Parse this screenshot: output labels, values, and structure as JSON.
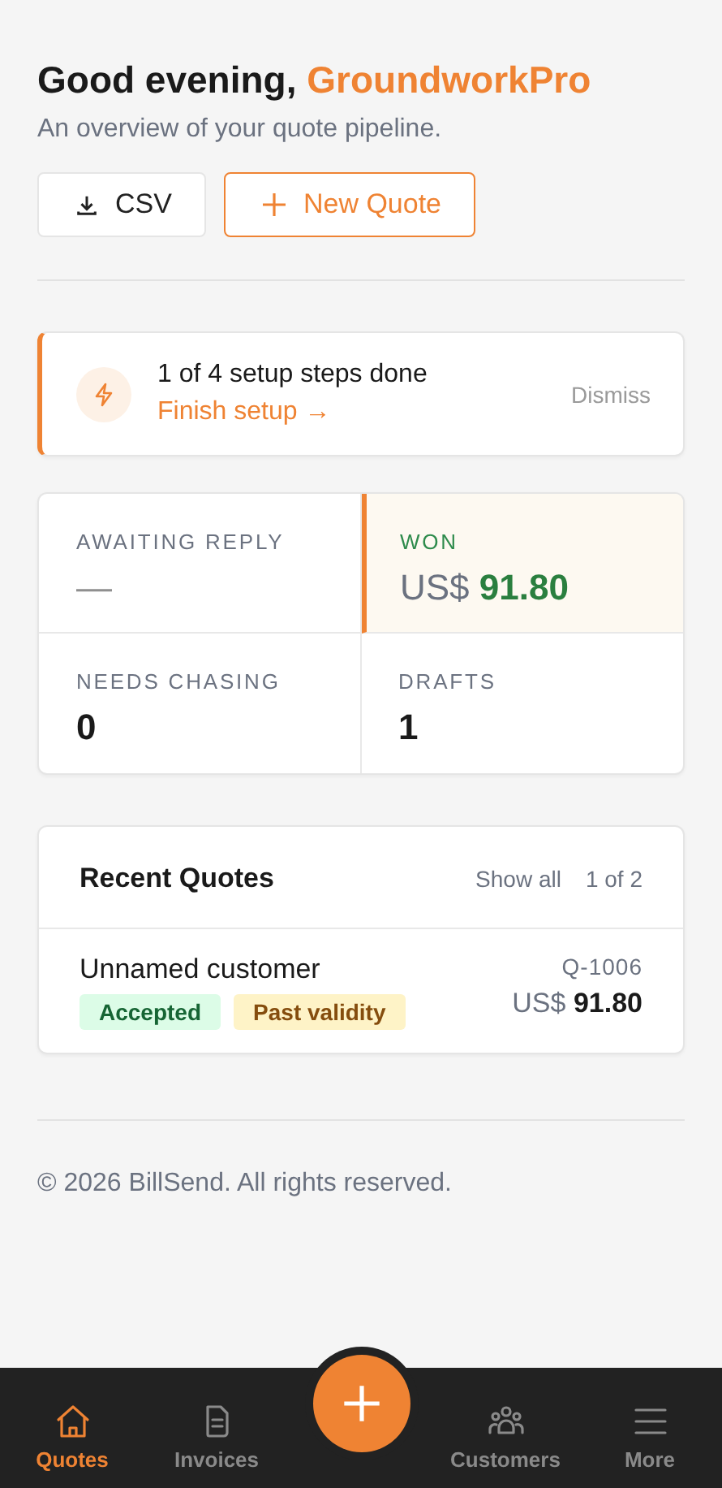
{
  "header": {
    "greeting": "Good evening,",
    "name": "GroundworkPro",
    "subtitle": "An overview of your quote pipeline."
  },
  "actions": [
    {
      "kind": "download",
      "label": "CSV"
    },
    {
      "kind": "add",
      "label": "New Quote"
    }
  ],
  "setup": {
    "progress": "1 of 4 setup steps done",
    "link": "Finish setup →",
    "dismiss": "Dismiss"
  },
  "stats": [
    {
      "label": "AWAITING REPLY",
      "value": "—",
      "empty": true,
      "highlighted": false
    },
    {
      "label": "WON",
      "prefix": "US$",
      "value": "91.80",
      "empty": false,
      "highlighted": true
    },
    {
      "label": "NEEDS CHASING",
      "value": "0",
      "empty": false,
      "highlighted": false
    },
    {
      "label": "DRAFTS",
      "value": "1",
      "empty": false,
      "highlighted": false
    }
  ],
  "recent_quotes": {
    "title": "Recent Quotes",
    "show_all": "Show all",
    "page": "1 of 2",
    "rows": [
      {
        "customer": "Unnamed customer",
        "number": "Q-1006",
        "currency": "US$",
        "amount": "91.80",
        "tags": [
          {
            "label": "Accepted",
            "color": "#dcfce7"
          },
          {
            "label": "Past validity",
            "color": "#fef3c7"
          }
        ]
      }
    ]
  },
  "footer": "© 2026 BillSend. All rights reserved.",
  "nav": [
    {
      "kind": "home",
      "label": "Quotes",
      "selected": true
    },
    {
      "kind": "document",
      "label": "Invoices",
      "selected": false
    },
    {
      "kind": "add",
      "selected": false
    },
    {
      "kind": "people",
      "label": "Customers",
      "selected": false
    },
    {
      "kind": "menu",
      "label": "More",
      "selected": false
    }
  ]
}
